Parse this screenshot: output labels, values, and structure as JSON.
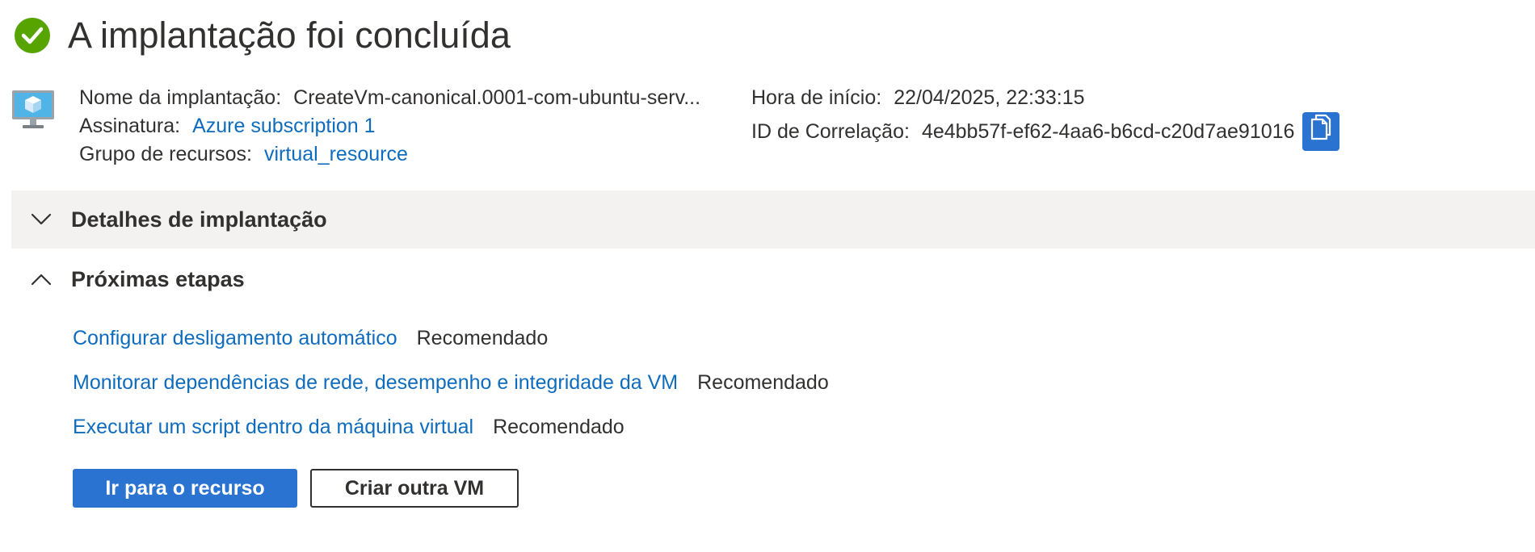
{
  "header": {
    "title": "A implantação foi concluída",
    "status_icon": "checkmark-circle-icon",
    "status_color": "#57a300"
  },
  "info": {
    "deployment_name_label": "Nome da implantação:",
    "deployment_name_value": "CreateVm-canonical.0001-com-ubuntu-serv...",
    "subscription_label": "Assinatura:",
    "subscription_value": "Azure subscription 1",
    "resource_group_label": "Grupo de recursos:",
    "resource_group_value": "virtual_resource",
    "start_time_label": "Hora de início:",
    "start_time_value": "22/04/2025, 22:33:15",
    "correlation_id_label": "ID de Correlação:",
    "correlation_id_value": "4e4bb57f-ef62-4aa6-b6cd-c20d7ae91016",
    "vm_icon": "virtual-machine-icon",
    "copy_icon": "copy-icon"
  },
  "sections": {
    "details_title": "Detalhes de implantação",
    "details_expanded": false,
    "next_steps_title": "Próximas etapas",
    "next_steps_expanded": true
  },
  "next_steps": [
    {
      "link": "Configurar desligamento automático",
      "badge": "Recomendado"
    },
    {
      "link": "Monitorar dependências de rede, desempenho e integridade da VM",
      "badge": "Recomendado"
    },
    {
      "link": "Executar um script dentro da máquina virtual",
      "badge": "Recomendado"
    }
  ],
  "buttons": {
    "primary_label": "Ir para o recurso",
    "secondary_label": "Criar outra VM"
  },
  "colors": {
    "accent": "#2b73d0",
    "link": "#0f6cbd",
    "text": "#323130",
    "section_bg": "#f3f2f1"
  }
}
